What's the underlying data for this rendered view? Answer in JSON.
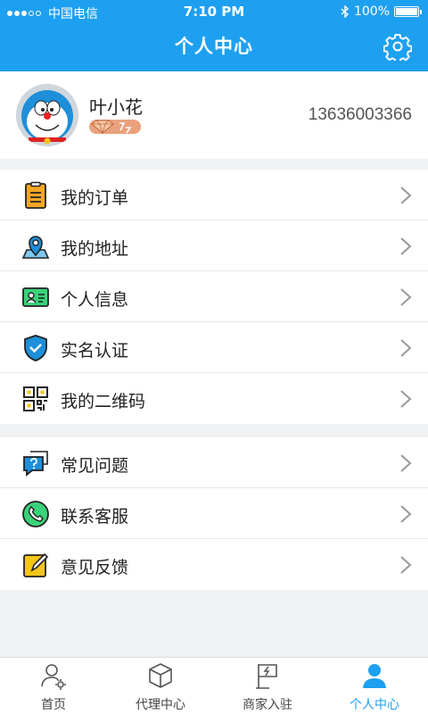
{
  "status_bar": {
    "carrier": "中国电信",
    "time": "7:10 PM",
    "battery": "100%",
    "signal_bars_filled": 3,
    "signal_bars_total": 5
  },
  "header": {
    "title": "个人中心",
    "settings_icon": "gear-icon",
    "background_color": "#1ea0f0"
  },
  "profile": {
    "name": "叶小花",
    "phone": "13636003366",
    "badge_icon": "diamond-icon"
  },
  "menu_group_1": [
    {
      "label": "我的订单",
      "icon": "order-icon"
    },
    {
      "label": "我的地址",
      "icon": "location-icon"
    },
    {
      "label": "个人信息",
      "icon": "id-card-icon"
    },
    {
      "label": "实名认证",
      "icon": "shield-check-icon"
    },
    {
      "label": "我的二维码",
      "icon": "qrcode-icon"
    }
  ],
  "menu_group_2": [
    {
      "label": "常见问题",
      "icon": "question-chat-icon"
    },
    {
      "label": "联系客服",
      "icon": "phone-icon"
    },
    {
      "label": "意见反馈",
      "icon": "edit-icon"
    }
  ],
  "tabbar": [
    {
      "label": "首页",
      "icon": "home-users-icon",
      "active": false
    },
    {
      "label": "代理中心",
      "icon": "cube-icon",
      "active": false
    },
    {
      "label": "商家入驻",
      "icon": "flag-icon",
      "active": false
    },
    {
      "label": "个人中心",
      "icon": "person-icon",
      "active": true
    }
  ],
  "colors": {
    "accent": "#1ea0f0",
    "background": "#f0f1f3",
    "vip_badge": "#e9a27d"
  }
}
